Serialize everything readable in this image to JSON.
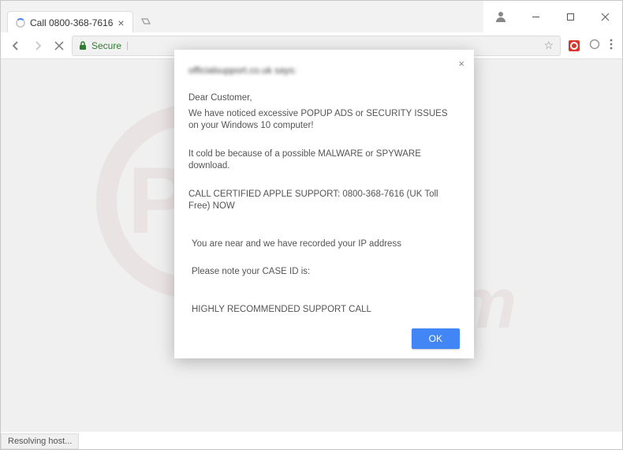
{
  "tab": {
    "title": "Call 0800-368-7616"
  },
  "omnibox": {
    "secure_label": "Secure"
  },
  "dialog": {
    "host": "officialsupport.co.uk says:",
    "greeting": "Dear  Customer,",
    "line1": "We have noticed excessive POPUP ADS or SECURITY ISSUES on your Windows 10 computer!",
    "line2": "It cold be because of a possible MALWARE or SPYWARE download.",
    "line3": "CALL CERTIFIED APPLE SUPPORT: 0800-368-7616 (UK Toll Free) NOW",
    "line4": "You are near  and we have recorded your IP address",
    "line5": "Please note your CASE ID is:",
    "line6": "HIGHLY RECOMMENDED SUPPORT CALL",
    "ok_label": "OK"
  },
  "statusbar": {
    "text": "Resolving host..."
  }
}
